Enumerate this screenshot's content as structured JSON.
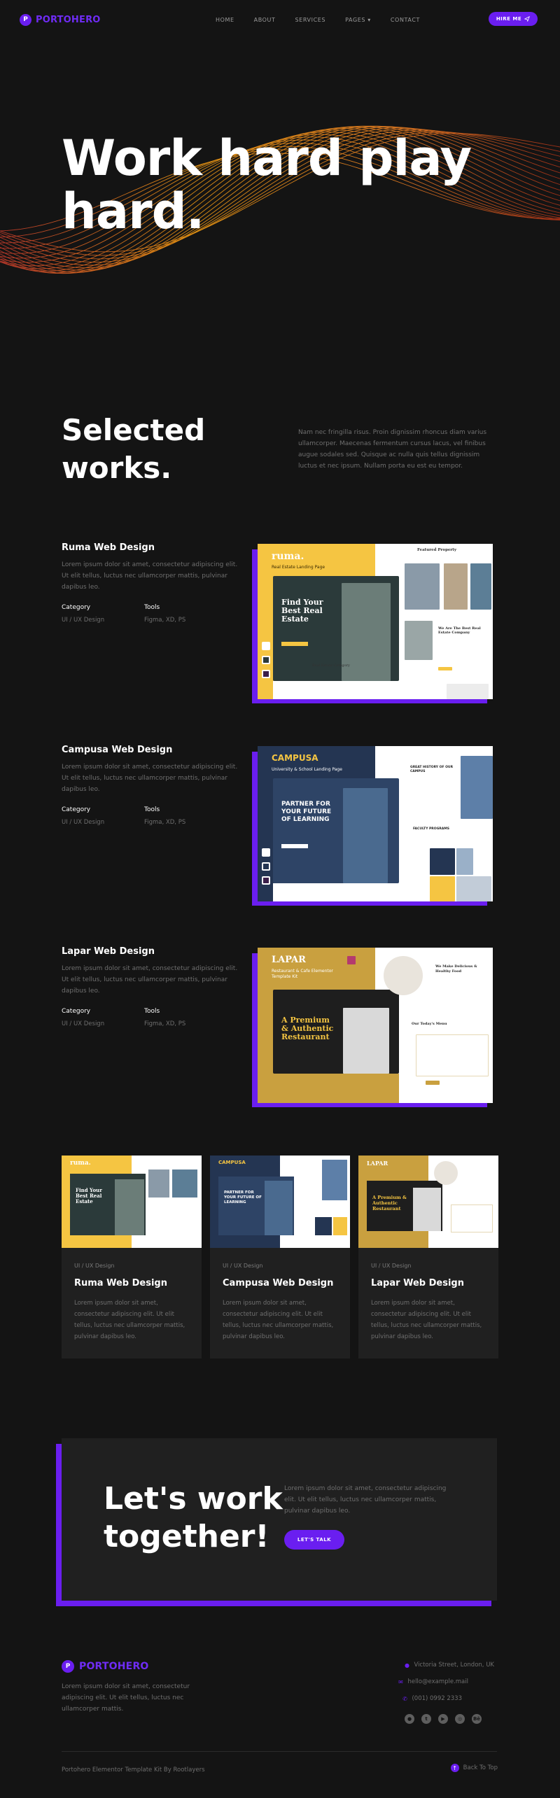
{
  "nav": {
    "logo_mark": "P",
    "logo_text": "PORTOHERO",
    "items": [
      "HOME",
      "ABOUT",
      "SERVICES",
      "PAGES",
      "CONTACT"
    ],
    "pages_chevron": "▾",
    "hire": "HIRE ME",
    "hire_icon": "send-icon"
  },
  "hero": {
    "title_line1": "Work hard play",
    "title_line2": "hard."
  },
  "selected": {
    "title_line1": "Selected",
    "title_line2": "works.",
    "description": "Nam nec fringilla risus. Proin dignissim rhoncus diam varius ullamcorper. Maecenas fermentum cursus lacus, vel finibus augue sodales sed. Quisque ac nulla quis tellus dignissim luctus et nec ipsum. Nullam porta eu est eu tempor."
  },
  "works": [
    {
      "title": "Ruma Web Design",
      "desc": "Lorem ipsum dolor sit amet, consectetur adipiscing elit. Ut elit tellus, luctus nec ullamcorper mattis, pulvinar dapibus leo.",
      "category_label": "Category",
      "category": "UI / UX Design",
      "tools_label": "Tools",
      "tools": "Figma, XD, PS",
      "shot": {
        "brand": "ruma.",
        "sub": "Real Estate Landing Page",
        "hero": "Find Your Best Real Estate",
        "right_title": "Featured Property",
        "right_sub": "We Are The Best Real Estate Company",
        "band": "Real Estate Category",
        "accent": "#f5c542",
        "dark": "#2b3a3a"
      }
    },
    {
      "title": "Campusa Web Design",
      "desc": "Lorem ipsum dolor sit amet, consectetur adipiscing elit. Ut elit tellus, luctus nec ullamcorper mattis, pulvinar dapibus leo.",
      "category_label": "Category",
      "category": "UI / UX Design",
      "tools_label": "Tools",
      "tools": "Figma, XD, PS",
      "shot": {
        "brand": "CAMPUSA",
        "sub": "University & School Landing Page",
        "hero": "PARTNER FOR YOUR FUTURE OF LEARNING",
        "right_title": "GREAT HISTORY OF OUR CAMPUS",
        "right_sub": "FACULTY PROGRAMS",
        "band": "",
        "accent": "#f5c542",
        "dark": "#243552"
      }
    },
    {
      "title": "Lapar Web Design",
      "desc": "Lorem ipsum dolor sit amet, consectetur adipiscing elit. Ut elit tellus, luctus nec ullamcorper mattis, pulvinar dapibus leo.",
      "category_label": "Category",
      "category": "UI / UX Design",
      "tools_label": "Tools",
      "tools": "Figma, XD, PS",
      "shot": {
        "brand": "LAPAR",
        "sub": "Restaurant & Cafe Elementor Template Kit",
        "hero": "A Premium & Authentic Restaurant",
        "right_title": "We Make Delicious & Healthy Food",
        "right_sub": "Our Today's Menu",
        "band": "",
        "accent": "#c9a03f",
        "dark": "#1e1e1e"
      }
    }
  ],
  "cards": [
    {
      "cat": "UI / UX Design",
      "title": "Ruma Web Design",
      "desc": "Lorem ipsum dolor sit amet, consectetur adipiscing elit. Ut elit tellus, luctus nec ullamcorper mattis, pulvinar dapibus leo."
    },
    {
      "cat": "UI / UX Design",
      "title": "Campusa Web Design",
      "desc": "Lorem ipsum dolor sit amet, consectetur adipiscing elit. Ut elit tellus, luctus nec ullamcorper mattis, pulvinar dapibus leo."
    },
    {
      "cat": "UI / UX Design",
      "title": "Lapar Web Design",
      "desc": "Lorem ipsum dolor sit amet, consectetur adipiscing elit. Ut elit tellus, luctus nec ullamcorper mattis, pulvinar dapibus leo."
    }
  ],
  "cta": {
    "title_line1": "Let's work",
    "title_line2": "together!",
    "desc": "Lorem ipsum dolor sit amet, consectetur adipiscing elit. Ut elit tellus, luctus nec ullamcorper mattis, pulvinar dapibus leo.",
    "button": "LET'S TALK"
  },
  "footer": {
    "logo_mark": "P",
    "logo_text": "PORTOHERO",
    "desc": "Lorem ipsum dolor sit amet, consectetur adipiscing elit. Ut elit tellus, luctus nec ullamcorper mattis.",
    "address": "Victoria Street, London, UK",
    "email": "hello@example.mail",
    "phone": "(001) 0992 2333",
    "social": [
      "github-icon",
      "twitter-icon",
      "youtube-icon",
      "dribbble-icon",
      "behance-icon"
    ],
    "behance_text": "Bē",
    "credit": "Portohero Elementor Template Kit By Rootlayers",
    "back_to_top": "Back To Top"
  },
  "colors": {
    "accent": "#6a1ef0",
    "bg": "#141414",
    "card": "#202020",
    "muted": "#6f6f6f"
  }
}
